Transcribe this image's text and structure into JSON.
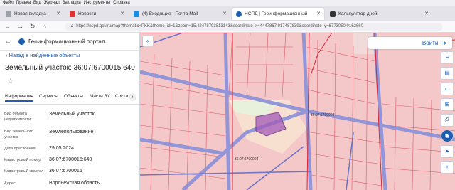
{
  "menubar": [
    "Файл",
    "Правка",
    "Вид",
    "Журнал",
    "Закладки",
    "Инструменты",
    "Справка"
  ],
  "tabs": [
    {
      "label": "Новая вкладка",
      "active": false,
      "color": "#9aa0a6"
    },
    {
      "label": "Новости",
      "active": false,
      "color": "#d33"
    },
    {
      "label": "(4) Входящие - Почта Mail",
      "active": false,
      "color": "#168de2"
    },
    {
      "label": "НСПД | Геоинформационный",
      "active": true,
      "color": "#1d5fb3"
    },
    {
      "label": "Калькулятор дней",
      "active": false,
      "color": "#333"
    }
  ],
  "nav": {
    "url": "https://nspd.gov.ru/map?thematic=PKK&theme_id=1&zoom=15.42478793813143&coordinate_x=4447867.917487839&coordinate_y=6773050.0162660"
  },
  "panel": {
    "portal_title": "Геоинформационный портал",
    "back_link": "Назад в найденные объекты",
    "object_title": "Земельный участок: 36:07:6700015:640",
    "tabs": [
      "Информация",
      "Сервисы",
      "Объекты",
      "Части ЗУ",
      "Соста"
    ],
    "fields": [
      {
        "label": "Вид объекта недвижимости",
        "value": "Земельный участок"
      },
      {
        "label": "Вид земельного участка",
        "value": "Землепользование"
      },
      {
        "label": "Дата присвоения",
        "value": "29.05.2024"
      },
      {
        "label": "Кадастровый номер",
        "value": "36:07:6700015:640"
      },
      {
        "label": "Кадастровый квартал",
        "value": "36:07:6700015"
      },
      {
        "label": "Адрес",
        "value": "Воронежская область"
      }
    ]
  },
  "map": {
    "login_label": "Войти",
    "labels": [
      "36:07:6700003",
      "36:07:6700004"
    ],
    "colors": {
      "parcel": "#f4c8c8",
      "road": "#8a90d8",
      "boundary": "#d9253a",
      "selected": "#7b3fa0"
    }
  }
}
